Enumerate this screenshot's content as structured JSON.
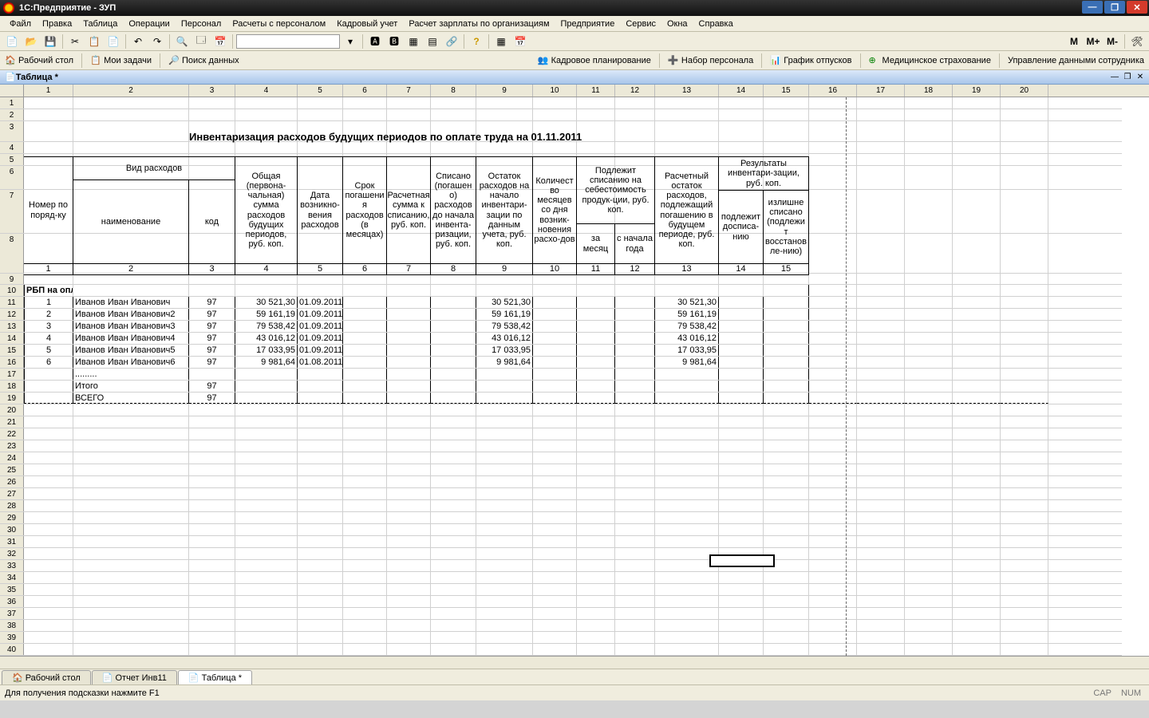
{
  "app_title": "1С:Предприятие - ЗУП",
  "menu": [
    "Файл",
    "Правка",
    "Таблица",
    "Операции",
    "Персонал",
    "Расчеты с персоналом",
    "Кадровый учет",
    "Расчет зарплаты по организациям",
    "Предприятие",
    "Сервис",
    "Окна",
    "Справка"
  ],
  "toolbar2": {
    "desktop": "Рабочий стол",
    "tasks": "Мои задачи",
    "search": "Поиск данных",
    "hr_plan": "Кадровое планирование",
    "recruit": "Набор персонала",
    "vacation": "График отпусков",
    "med": "Медицинское страхование",
    "mgmt": "Управление данными сотрудника"
  },
  "tab_marks": [
    "M",
    "М+",
    "М-"
  ],
  "doc_tab": "Таблица *",
  "column_numbers": [
    "1",
    "2",
    "3",
    "4",
    "5",
    "6",
    "7",
    "8",
    "9",
    "10",
    "11",
    "12",
    "13",
    "14",
    "15",
    "16",
    "17",
    "18",
    "19",
    "20"
  ],
  "report_title": "Инвентаризация расходов будущих периодов по оплате труда на 01.11.2011",
  "headers": {
    "row_num": "Номер по поряд-ку",
    "type": "Вид расходов",
    "name": "наименование",
    "code": "код",
    "total": "Общая (первона-чальная) сумма расходов будущих периодов, руб. коп.",
    "date": "Дата возникно-вения расходов",
    "term": "Срок погашени я расходов (в месяцах)",
    "calc": "Расчетная сумма к списанию, руб. коп.",
    "written": "Списано (погашен о) расходов до начала инвента-ризации, руб. коп.",
    "balance": "Остаток расходов на начало инвентари-зации по данным учета, руб. коп.",
    "months": "Количест во месяцев со дня возник-новения расхо-дов",
    "due": "Подлежит списанию на себестоимость продук-ции, руб. коп.",
    "per_month": "за месяц",
    "from_year": "с начала года",
    "calc_bal": "Расчетный остаток расходов, подлежащий погашению в будущем периоде, руб. коп.",
    "results": "Результаты инвентари-зации, руб. коп.",
    "to_write": "подлежит досписа-нию",
    "excess": "излишне списано (подлежи т восстанов ле-нию)"
  },
  "num_row": [
    "1",
    "2",
    "3",
    "4",
    "5",
    "6",
    "7",
    "8",
    "9",
    "10",
    "11",
    "12",
    "13",
    "14",
    "15"
  ],
  "section": "РБП на оплату труда",
  "data_rows": [
    {
      "n": "1",
      "name": "Иванов Иван Иванович",
      "code": "97",
      "sum": "30 521,30",
      "date": "01.09.2011",
      "bal": "30 521,30",
      "calc": "30 521,30"
    },
    {
      "n": "2",
      "name": "Иванов Иван Иванович2",
      "code": "97",
      "sum": "59 161,19",
      "date": "01.09.2011",
      "bal": "59 161,19",
      "calc": "59 161,19"
    },
    {
      "n": "3",
      "name": "Иванов Иван Иванович3",
      "code": "97",
      "sum": "79 538,42",
      "date": "01.09.2011",
      "bal": "79 538,42",
      "calc": "79 538,42"
    },
    {
      "n": "4",
      "name": "Иванов Иван Иванович4",
      "code": "97",
      "sum": "43 016,12",
      "date": "01.09.2011",
      "bal": "43 016,12",
      "calc": "43 016,12"
    },
    {
      "n": "5",
      "name": "Иванов Иван Иванович5",
      "code": "97",
      "sum": "17 033,95",
      "date": "01.09.2011",
      "bal": "17 033,95",
      "calc": "17 033,95"
    },
    {
      "n": "6",
      "name": "Иванов Иван Иванович6",
      "code": "97",
      "sum": "9 981,64",
      "date": "01.08.2011",
      "bal": "9 981,64",
      "calc": "9 981,64"
    }
  ],
  "dots": ".........",
  "itogo": {
    "label": "Итого",
    "code": "97"
  },
  "vsego": {
    "label": "ВСЕГО",
    "code": "97"
  },
  "bottom_tabs": [
    "Рабочий стол",
    "Отчет  Инв11",
    "Таблица *"
  ],
  "status": "Для получения подсказки нажмите F1",
  "status_right": [
    "CAP",
    "NUM"
  ]
}
